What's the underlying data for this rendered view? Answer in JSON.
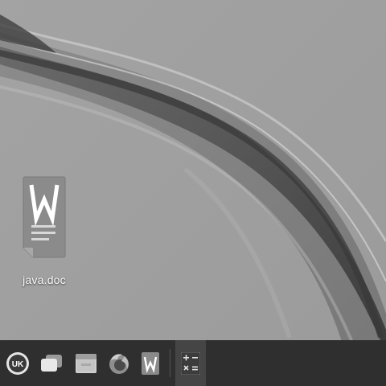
{
  "desktop": {
    "icons": [
      {
        "label": "java.doc",
        "icon": "wps-writer-document-icon"
      }
    ]
  },
  "taskbar": {
    "items": [
      {
        "name": "ukui-start-menu",
        "icon": "uk-logo-icon",
        "text": "UK"
      },
      {
        "name": "show-desktop",
        "icon": "windows-switch-icon"
      },
      {
        "name": "file-manager",
        "icon": "folder-icon"
      },
      {
        "name": "firefox",
        "icon": "firefox-icon"
      },
      {
        "name": "wps-writer",
        "icon": "wps-writer-icon",
        "text": "W"
      },
      {
        "name": "calculator",
        "icon": "calculator-icon",
        "text": "+ − × ="
      }
    ]
  },
  "colors": {
    "wallpaper_base": "#9a9a9a",
    "taskbar": "#2f2f2f",
    "doc_icon": "#8a8a8a"
  }
}
